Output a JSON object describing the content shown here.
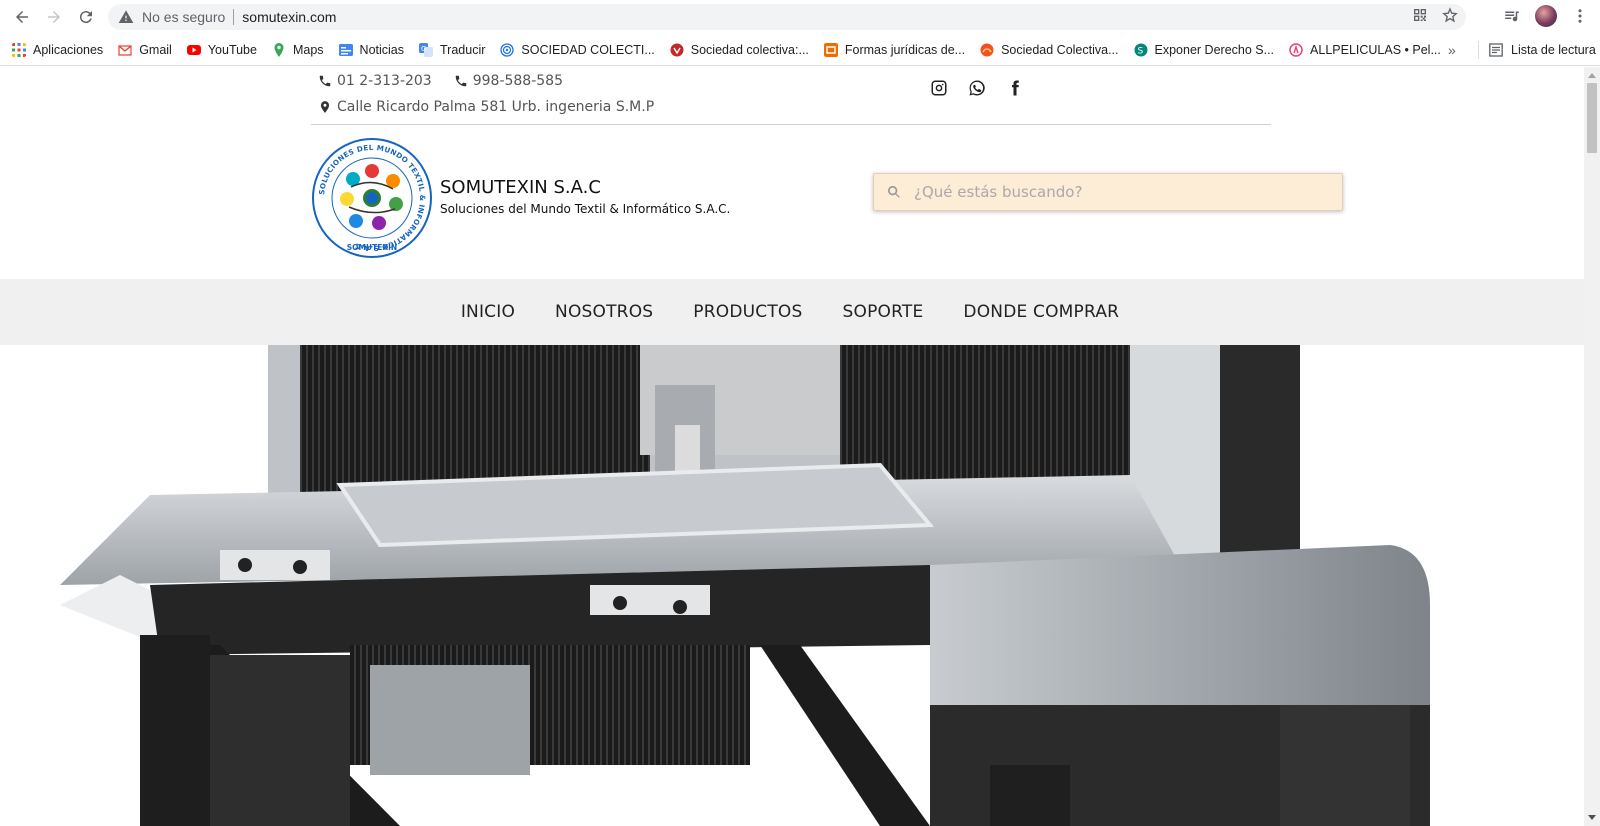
{
  "browser": {
    "address": {
      "security_label": "No es seguro",
      "url": "somutexin.com"
    },
    "bookmarks": [
      {
        "label": "Aplicaciones",
        "icon": "apps-grid-icon",
        "color": "#4285f4"
      },
      {
        "label": "Gmail",
        "icon": "gmail-icon",
        "color": "#ea4335"
      },
      {
        "label": "YouTube",
        "icon": "youtube-icon",
        "color": "#ff0000"
      },
      {
        "label": "Maps",
        "icon": "maps-icon",
        "color": "#34a853"
      },
      {
        "label": "Noticias",
        "icon": "news-icon",
        "color": "#4285f4"
      },
      {
        "label": "Traducir",
        "icon": "translate-icon",
        "color": "#4285f4"
      },
      {
        "label": "SOCIEDAD COLECTI...",
        "icon": "globe-icon",
        "color": "#1a73e8"
      },
      {
        "label": "Sociedad colectiva:...",
        "icon": "site-icon",
        "color": "#c62828"
      },
      {
        "label": "Formas jurídicas de...",
        "icon": "site-icon",
        "color": "#ef6c00"
      },
      {
        "label": "Sociedad Colectiva...",
        "icon": "site-icon",
        "color": "#f4511e"
      },
      {
        "label": "Exponer Derecho S...",
        "icon": "site-icon",
        "color": "#00897b"
      },
      {
        "label": "ALLPELICULAS • Pel...",
        "icon": "site-icon",
        "color": "#ec407a"
      }
    ],
    "reading_list": "Lista de lectura"
  },
  "site": {
    "phone1": "01 2-313-203",
    "phone2": "998-588-585",
    "address": "Calle Ricardo Palma 581 Urb. ingeneria S.M.P",
    "brand_title": "SOMUTEXIN S.A.C",
    "brand_subtitle": "Soluciones del Mundo Textil & Informático S.A.C.",
    "search_placeholder": "¿Qué estás buscando?",
    "logo_ring_text": "SOLUCIONES DEL MUNDO TEXTIL & INFORMATICO S.A.C",
    "logo_bottom_text": "SOMUTEXIN",
    "nav": [
      "INICIO",
      "NOSOTROS",
      "PRODUCTOS",
      "SOPORTE",
      "DONDE COMPRAR"
    ]
  }
}
